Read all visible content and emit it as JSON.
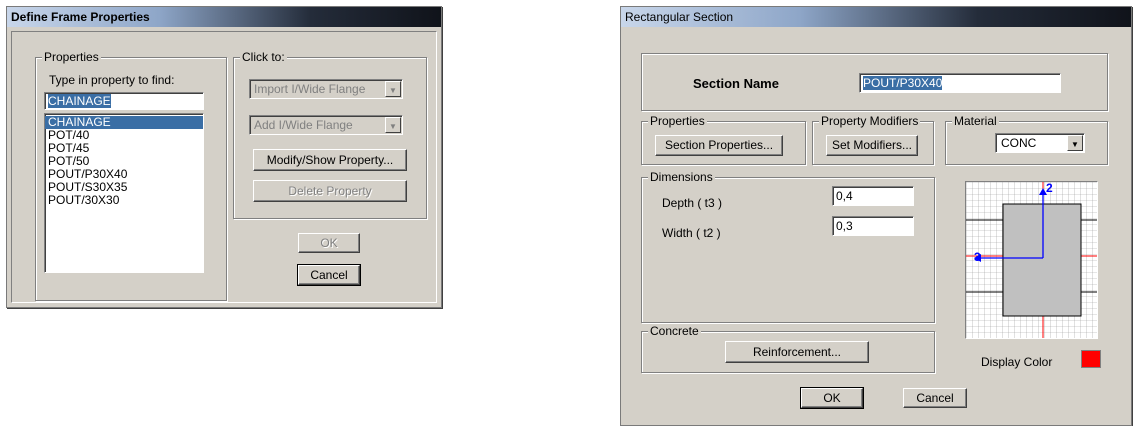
{
  "define_frame": {
    "title": "Define Frame Properties",
    "properties_group": "Properties",
    "find_label": "Type in property to find:",
    "find_value": "CHAINAGE",
    "list_items": [
      "CHAINAGE",
      "POT/40",
      "POT/45",
      "POT/50",
      "POUT/P30X40",
      "POUT/S30X35",
      "POUT/30X30"
    ],
    "click_to_group": "Click to:",
    "import_combo": "Import I/Wide Flange",
    "add_combo": "Add I/Wide Flange",
    "modify_button": "Modify/Show Property...",
    "delete_button": "Delete Property",
    "ok_button": "OK",
    "cancel_button": "Cancel"
  },
  "rect_section": {
    "title": "Rectangular Section",
    "section_name_label": "Section Name",
    "section_name_value": "POUT/P30X40",
    "properties_group": "Properties",
    "section_properties_button": "Section Properties...",
    "modifiers_group": "Property Modifiers",
    "set_modifiers_button": "Set Modifiers...",
    "material_group": "Material",
    "material_value": "CONC",
    "dimensions_group": "Dimensions",
    "depth_label": "Depth  ( t3 )",
    "depth_value": "0,4",
    "width_label": "Width  ( t2 )",
    "width_value": "0,3",
    "axis_2": "2",
    "axis_3": "3",
    "concrete_group": "Concrete",
    "reinforcement_button": "Reinforcement...",
    "display_color_label": "Display Color",
    "display_color": "#ff0000",
    "ok_button": "OK",
    "cancel_button": "Cancel"
  },
  "colors": {
    "selection": "#3a6ea5",
    "dialog_face": "#d4d0c8"
  }
}
